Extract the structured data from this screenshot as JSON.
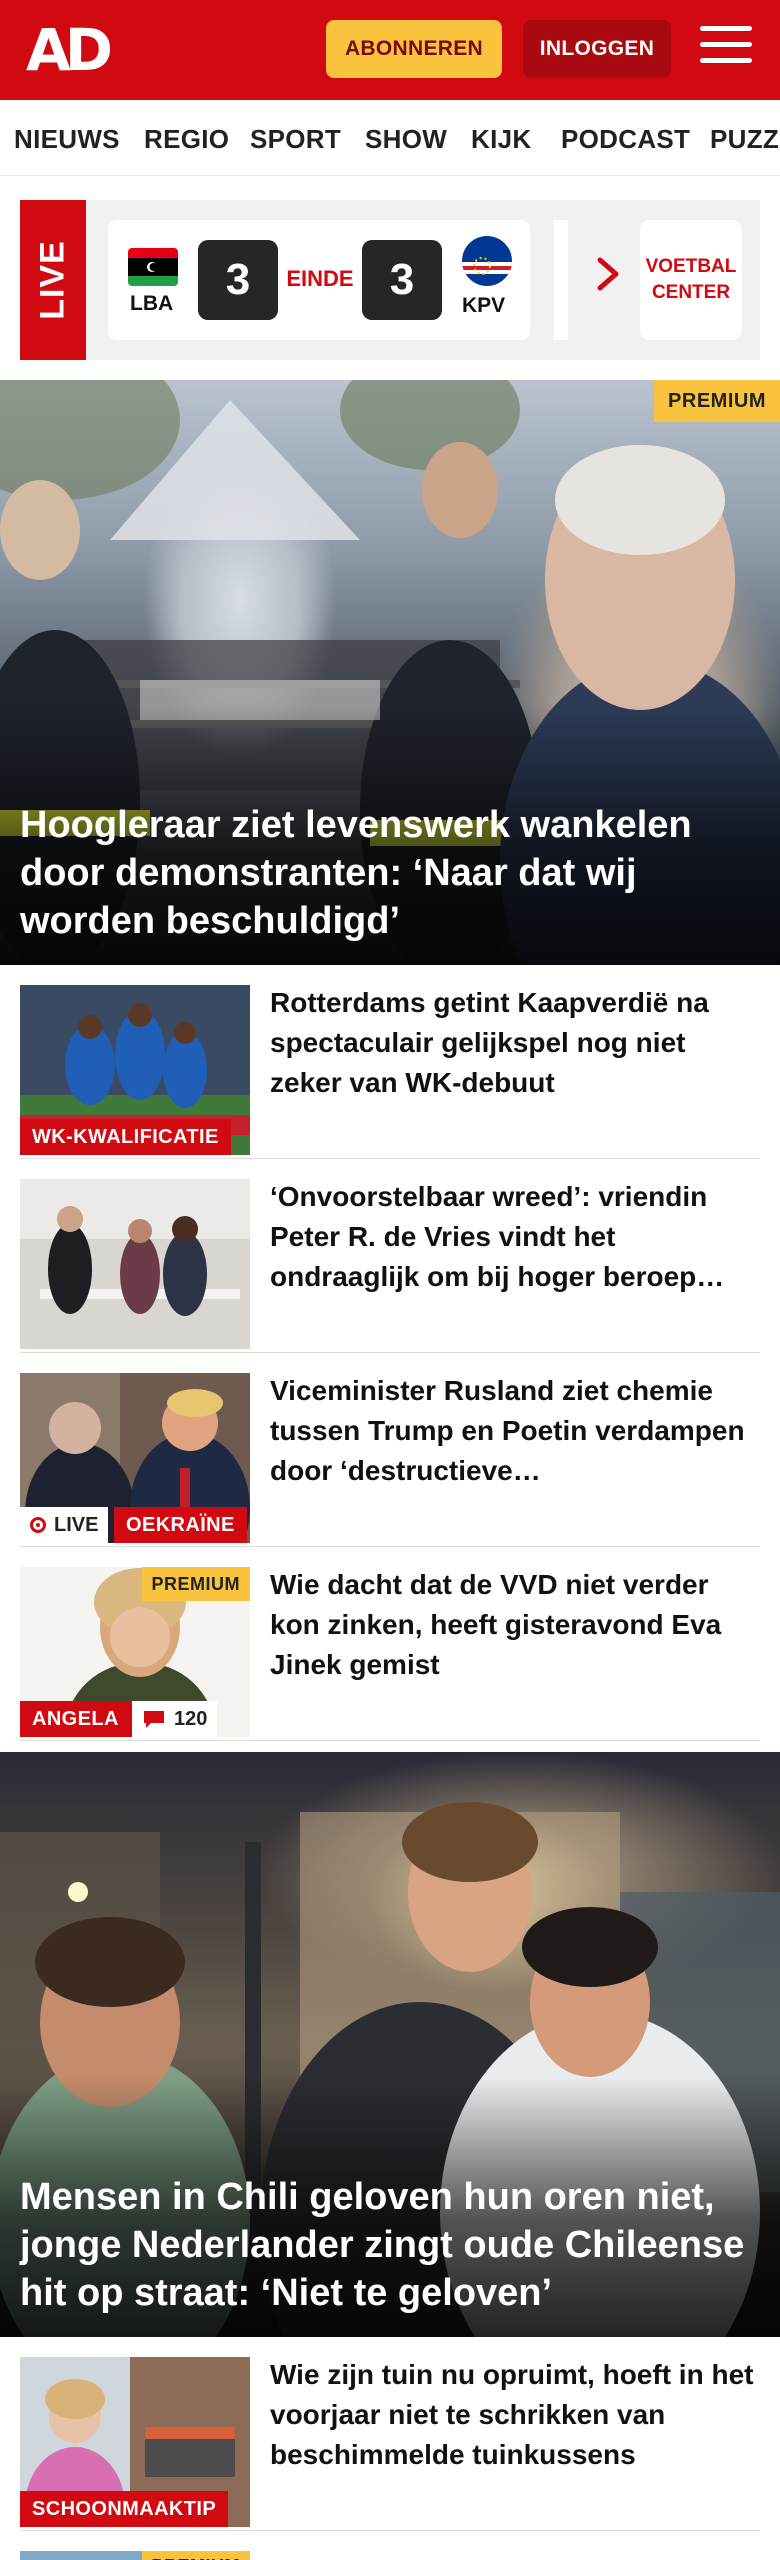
{
  "header": {
    "logo": "AD",
    "subscribe_label": "ABONNEREN",
    "login_label": "INLOGGEN",
    "brand_color": "#d10a11",
    "accent_color": "#f9c33d"
  },
  "nav": {
    "items": [
      "NIEUWS",
      "REGIO",
      "SPORT",
      "SHOW",
      "KIJK",
      "PODCAST",
      "PUZZ"
    ]
  },
  "live": {
    "label": "LIVE",
    "match": {
      "home_code": "LBA",
      "home_score": "3",
      "status": "EINDE",
      "away_score": "3",
      "away_code": "KPV"
    },
    "voetbal_center": "VOETBAL CENTER"
  },
  "hero1": {
    "badge": "PREMIUM",
    "title": "Hoogleraar ziet levenswerk wankelen door demonstranten: ‘Naar dat wij worden beschuldigd’"
  },
  "articles": [
    {
      "title": "Rotterdams getint Kaapverdië na spectaculair gelijkspel nog niet zeker van WK-debuut",
      "tag": "WK-KWALIFICATIE"
    },
    {
      "title": "‘Onvoorstelbaar wreed’: vriendin Peter R. de Vries vindt het ondraaglijk om bij hoger beroep…"
    },
    {
      "title": "Viceminister Rusland ziet chemie tussen Trump en Poetin verdampen door ‘destructieve…",
      "live_label": "LIVE",
      "tag": "OEKRAÏNE"
    },
    {
      "title": "Wie dacht dat de VVD niet verder kon zinken, heeft gisteravond Eva Jinek gemist",
      "badge": "PREMIUM",
      "tag": "ANGELA",
      "comments": "120"
    }
  ],
  "hero2": {
    "title": "Mensen in Chili geloven hun oren niet, jonge Nederlander zingt oude Chileense hit op straat: ‘Niet te geloven’"
  },
  "articles2": [
    {
      "title": "Wie zijn tuin nu opruimt, hoeft in het voorjaar niet te schrikken van beschimmelde tuinkussens",
      "tag": "SCHOONMAAKTIP"
    },
    {
      "badge": "PREMIUM"
    }
  ]
}
